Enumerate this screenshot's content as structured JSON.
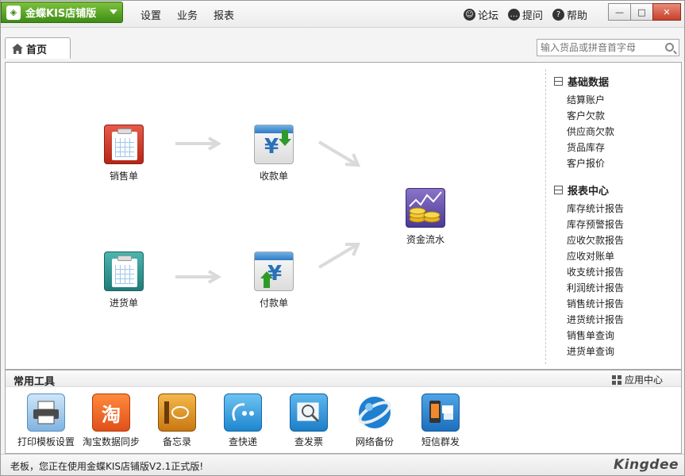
{
  "app": {
    "brand_label": "金蝶KIS店铺版",
    "menu": [
      "设置",
      "业务",
      "报表"
    ],
    "toplinks": [
      {
        "label": "论坛",
        "icon": "forum-icon"
      },
      {
        "label": "提问",
        "icon": "question-bubble-icon"
      },
      {
        "label": "帮助",
        "icon": "help-icon"
      }
    ],
    "window_controls": {
      "min": "—",
      "max": "□",
      "close": "✕"
    }
  },
  "tabs": {
    "home_label": "首页",
    "search_placeholder": "输入货品或拼音首字母"
  },
  "flow": {
    "sales_order": "销售单",
    "receipt": "收款单",
    "cashflow": "资金流水",
    "purchase_order": "进货单",
    "payment": "付款单"
  },
  "side": {
    "basic_title": "基础数据",
    "basic_links": [
      "结算账户",
      "客户欠款",
      "供应商欠款",
      "货品库存",
      "客户报价"
    ],
    "report_title": "报表中心",
    "report_links": [
      "库存统计报告",
      "库存预警报告",
      "应收欠款报告",
      "应收对账单",
      "收支统计报告",
      "利润统计报告",
      "销售统计报告",
      "进货统计报告",
      "销售单查询",
      "进货单查询"
    ]
  },
  "tools": {
    "title": "常用工具",
    "app_center": "应用中心",
    "items": [
      {
        "label": "打印模板设置",
        "icon": "printer-icon"
      },
      {
        "label": "淘宝数据同步",
        "icon": "taobao-icon",
        "glyph": "淘"
      },
      {
        "label": "备忘录",
        "icon": "memo-notebook-icon"
      },
      {
        "label": "查快递",
        "icon": "express-icon"
      },
      {
        "label": "查发票",
        "icon": "invoice-search-icon"
      },
      {
        "label": "网络备份",
        "icon": "network-backup-icon"
      },
      {
        "label": "短信群发",
        "icon": "sms-phone-icon"
      }
    ]
  },
  "status": {
    "text": "老板，您正在使用金蝶KIS店铺版V2.1正式版!",
    "logo_text": "Kingdee"
  }
}
